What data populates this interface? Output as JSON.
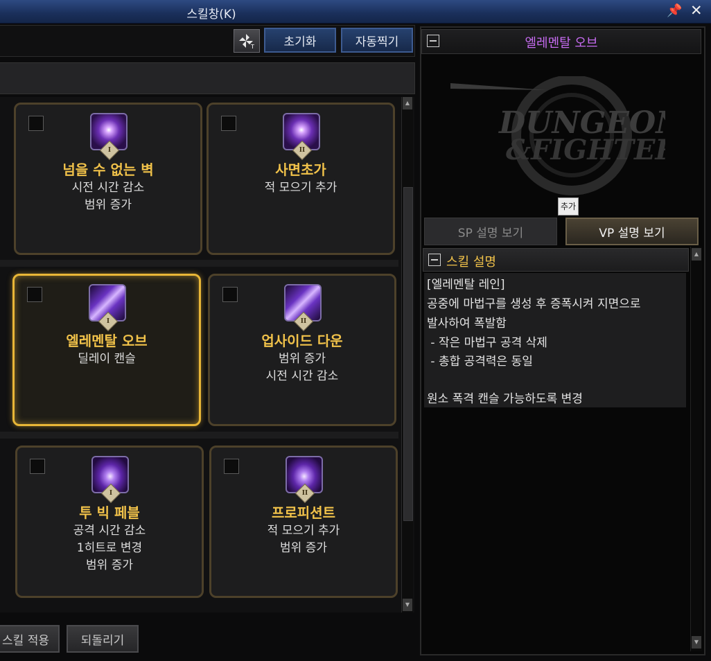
{
  "window": {
    "title": "스킬창(K)"
  },
  "toolbar": {
    "reset_label": "초기화",
    "auto_label": "자동찍기"
  },
  "skills": [
    {
      "name": "넘을 수 없는 벽",
      "desc": [
        "시전 시간 감소",
        "범위 증가"
      ],
      "tier": "I",
      "selected": false
    },
    {
      "name": "사면초가",
      "desc": [
        "적 모으기 추가"
      ],
      "tier": "II",
      "selected": false
    },
    {
      "name": "엘레멘탈 오브",
      "desc": [
        "딜레이 캔슬"
      ],
      "tier": "I",
      "selected": true
    },
    {
      "name": "업사이드 다운",
      "desc": [
        "범위 증가",
        "시전 시간 감소"
      ],
      "tier": "II",
      "selected": false
    },
    {
      "name": "투 빅 페블",
      "desc": [
        "공격 시간 감소",
        "1히트로 변경",
        "범위 증가"
      ],
      "tier": "I",
      "selected": false
    },
    {
      "name": "프로피션트",
      "desc": [
        "적 모으기 추가",
        "범위 증가"
      ],
      "tier": "II",
      "selected": false
    }
  ],
  "bottom": {
    "apply_label": "스킬 적용",
    "revert_label": "되돌리기"
  },
  "right_panel": {
    "title": "엘레멘탈 오브",
    "add_tag": "추가",
    "sp_tab": "SP 설명 보기",
    "vp_tab": "VP 설명 보기",
    "desc_title": "스킬 설명",
    "desc_lines": [
      "[엘레멘탈 레인]",
      "공중에 마법구를 생성 후 증폭시켜 지면으로",
      "발사하여 폭발함",
      " - 작은 마법구 공격 삭제",
      " - 총합 공격력은 동일",
      "",
      "원소 폭격 캔슬 가능하도록 변경"
    ]
  },
  "colors": {
    "accent_gold": "#f1c24a",
    "title_purple": "#c76cf2",
    "selected_border": "#e8b637"
  }
}
